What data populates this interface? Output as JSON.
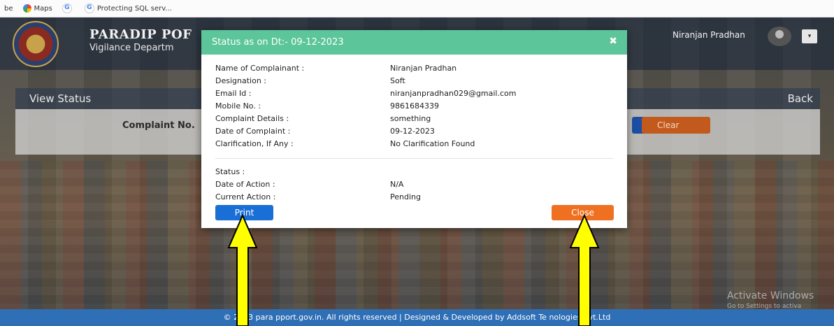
{
  "bookmarks": [
    {
      "label": "be",
      "icon": "none"
    },
    {
      "label": "Maps",
      "icon": "maps-icon"
    },
    {
      "label": "",
      "icon": "google-icon"
    },
    {
      "label": "Protecting SQL serv...",
      "icon": "google-icon"
    }
  ],
  "header": {
    "brand_title": "PARADIP POF",
    "brand_subtitle": "Vigilance Departm",
    "user_name": "Niranjan Pradhan",
    "menu_toggle": "▾"
  },
  "view_status": {
    "title": "View Status",
    "back": "Back",
    "complaint_label": "Complaint No.",
    "clear": "Clear"
  },
  "modal": {
    "title": "Status as on Dt:- 09-12-2023",
    "close_icon": "✖",
    "fields": [
      {
        "label": "Name of Complainant :",
        "value": "Niranjan Pradhan"
      },
      {
        "label": "Designation :",
        "value": "Soft"
      },
      {
        "label": "Email Id :",
        "value": "niranjanpradhan029@gmail.com"
      },
      {
        "label": "Mobile No. :",
        "value": "9861684339"
      },
      {
        "label": "Complaint Details :",
        "value": "something"
      },
      {
        "label": "Date of Complaint :",
        "value": "09-12-2023"
      },
      {
        "label": "Clarification, If Any :",
        "value": "No Clarification Found"
      }
    ],
    "status_fields": [
      {
        "label": "Status :",
        "value": ""
      },
      {
        "label": "Date of Action :",
        "value": "N/A"
      },
      {
        "label": "Current Action :",
        "value": "Pending"
      }
    ],
    "print": "Print",
    "close": "Close"
  },
  "watermark": {
    "title": "Activate Windows",
    "subtitle": "Go to Settings to activa"
  },
  "footer": {
    "text": "© 2023 para  pport.gov.in. All rights reserved | Designed & Developed by Addsoft Te  nologies Pvt.Ltd"
  },
  "colors": {
    "modal_header": "#5cc59a",
    "print_button": "#1a6fd6",
    "close_button": "#f07022",
    "footer": "#2f6fb5",
    "arrow_fill": "#ffff00"
  }
}
